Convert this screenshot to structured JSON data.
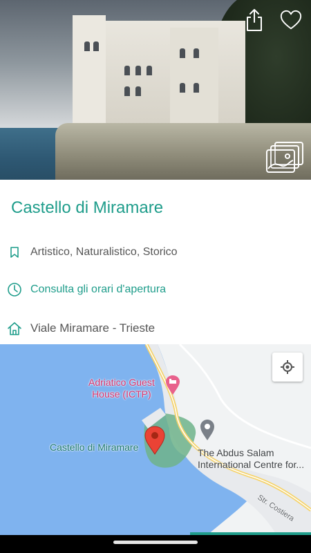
{
  "place": {
    "title": "Castello di Miramare",
    "categories": "Artistico, Naturalistico, Storico",
    "hours_link": "Consulta gli orari d'apertura",
    "address": "Viale Miramare  - Trieste"
  },
  "map": {
    "hotel_label_line1": "Adriatico Guest",
    "hotel_label_line2": "House (ICTP)",
    "castle_label": "Castello di Miramare",
    "poi_label_line1": "The Abdus Salam",
    "poi_label_line2": "International Centre for...",
    "road_label": "Str. Costiera"
  },
  "icons": {
    "share": "share-icon",
    "favorite": "heart-icon",
    "gallery": "gallery-icon",
    "category": "bookmark-icon",
    "hours": "clock-icon",
    "address": "home-icon",
    "locate": "my-location-icon"
  },
  "colors": {
    "accent": "#1f9d8b",
    "hotel_pin": "#d6336c",
    "map_water": "#7fb3ef",
    "map_land": "#f1f3f4",
    "park": "#6eb38a"
  }
}
